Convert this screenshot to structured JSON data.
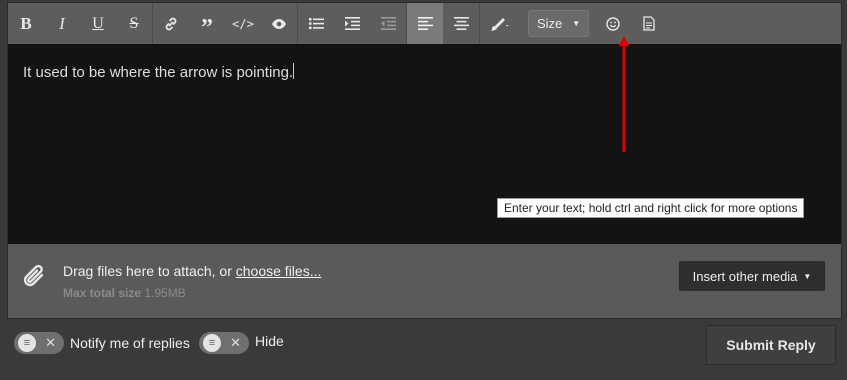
{
  "toolbar": {
    "size_label": "Size",
    "active_button": "align-left"
  },
  "editor": {
    "text": "It used to be where the arrow is pointing.",
    "tooltip": "Enter your text; hold ctrl and right click for more options"
  },
  "attach": {
    "drag_text": "Drag files here to attach, or ",
    "choose_files": "choose files...",
    "max_label": "Max total size",
    "max_value": "1.95MB",
    "media_button": "Insert other media"
  },
  "options": {
    "notify_label": "Notify me of replies",
    "hide_label": "Hide",
    "submit_label": "Submit Reply"
  },
  "colors": {
    "toolbar_bg": "#5d5d5d",
    "editor_bg": "#131313",
    "arrow": "#e00000"
  }
}
